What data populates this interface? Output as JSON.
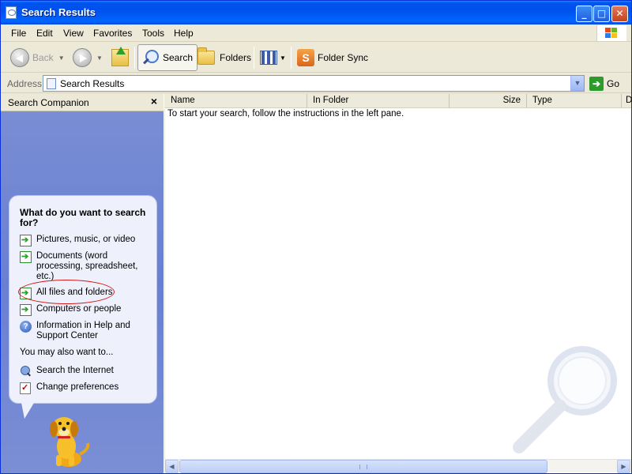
{
  "window": {
    "title": "Search Results",
    "controls": [
      "minimize",
      "maximize",
      "close"
    ]
  },
  "menubar": {
    "items": [
      "File",
      "Edit",
      "View",
      "Favorites",
      "Tools",
      "Help"
    ]
  },
  "toolbar": {
    "back_label": "Back",
    "search_label": "Search",
    "folders_label": "Folders",
    "folder_sync_label": "Folder Sync"
  },
  "address": {
    "label": "Address",
    "value": "Search Results",
    "go_label": "Go"
  },
  "search_companion": {
    "title": "Search Companion",
    "close_glyph": "×",
    "question": "What do you want to search for?",
    "options": [
      {
        "label": "Pictures, music, or video",
        "icon": "green-arrow-icon"
      },
      {
        "label": "Documents (word processing, spreadsheet, etc.)",
        "icon": "green-arrow-icon"
      },
      {
        "label": "All files and folders",
        "icon": "green-arrow-icon",
        "highlighted": true
      },
      {
        "label": "Computers or people",
        "icon": "green-arrow-icon"
      },
      {
        "label": "Information in Help and Support Center",
        "icon": "help-icon"
      }
    ],
    "also_label": "You may also want to...",
    "also_options": [
      {
        "label": "Search the Internet",
        "icon": "globe-search-icon"
      },
      {
        "label": "Change preferences",
        "icon": "preferences-icon"
      }
    ]
  },
  "results": {
    "columns": [
      "Name",
      "In Folder",
      "Size",
      "Type",
      "D"
    ],
    "empty_message": "To start your search, follow the instructions in the left pane."
  },
  "colors": {
    "titlebar": "#0050ee",
    "pane_background": "#6a7fd0",
    "highlight_ellipse": "#d01a1a"
  }
}
